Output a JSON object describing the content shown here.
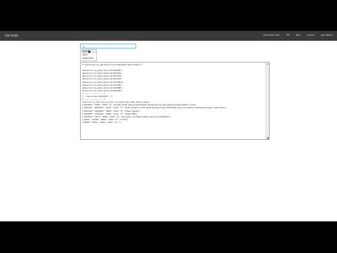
{
  "navbar": {
    "brand": "CM Tools",
    "links": [
      "Generate Card",
      "PR",
      "Brix",
      "source",
      "spe Admin"
    ]
  },
  "search": {
    "value": "1"
  },
  "dropdown": {
    "items": [
      "alpha",
      "4321",
      "16431230"
    ],
    "active_index": 0
  },
  "editor": {
    "text": "/** select from cq_ujar where name='Diketahui' jauh di bibiru */\n\ndelete from cq_action where id=3023521;\ndelete from cq_action where id=3023411;\ndelete from cq_action where id=3023412;\ndelete from cq_action where id=3023413;\ndelete from cq_action where id=37162514;\ndelete from cq_action where id=2712007;\ndelete from cq_action where id=3023085;\ndelete from cq_action where id=3023081;\n/* -------------------------- */\n/* -- Insert Action 30231027 -- */\n/* -------------------------- */\ninsert into cq_action (id_id_name, id_reveal, type, data, param) values\n(\"3023521\", \"3030\", \"1101\", \"0\", \"di hujan aedsi naka melambankan batang kamna yang paling ketinggi kalakut. Treet\"),\n(\"3023411\", \"3023512\", \"3030\", \"1101\", \"0\", \"Tetah, berapan untuk dapat di kang hrung! Hasil balik saya menunjukan kebebasan berkau, suatu ratus\"),\n(\"3023413\", \"3023519\", \"3900\", \"1101\", \"0\", \"Tidak meltkan\"),\n(\"3023085\", \"3023514\", \"3008\", \"1101\", \"0\", \"Tidak 3008\"),\n(\"3023514\", \"3101\", \"3000\", \"1101\", \"0\", \"saya akan menukap updater saya menembakkan\"),\n(\"11081\", \"12030\", \"3900\", \"3104\", \"0\", \"1.0.34\"),\n(\"30826\", \"8004\", \"3000\", \"3104\", \"0\", \"\"),"
  },
  "colors": {
    "navbar_bg": "#3a3a3a",
    "page_bg": "#ffffff",
    "letterbox": "#000000",
    "input_border": "#8fb3d9"
  }
}
